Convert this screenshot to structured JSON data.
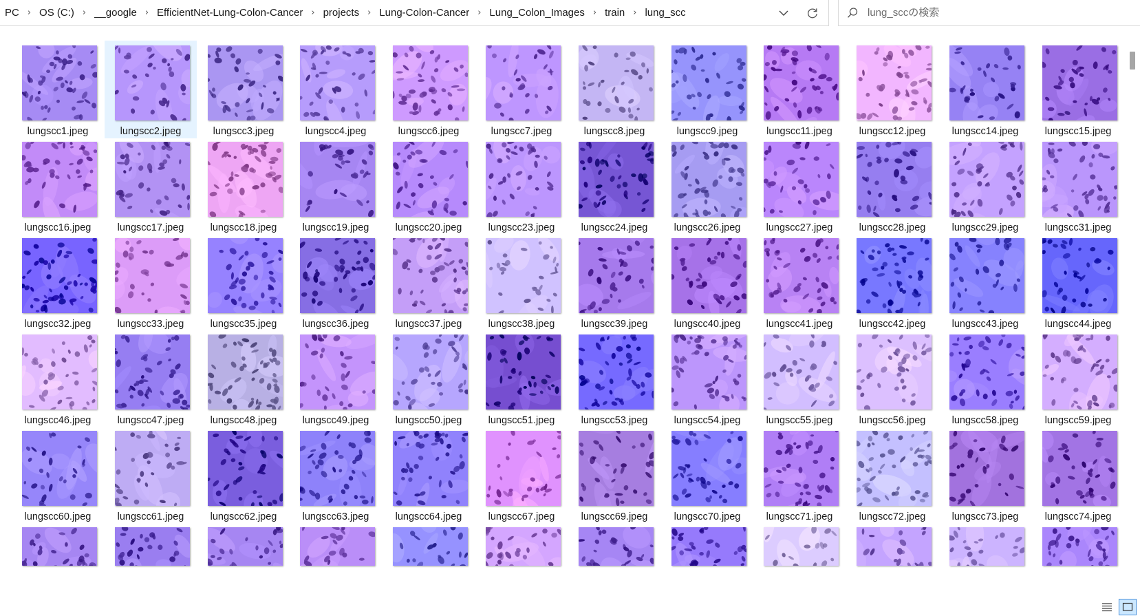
{
  "breadcrumb": {
    "items": [
      "PC",
      "OS (C:)",
      "__google",
      "EfficientNet-Lung-Colon-Cancer",
      "projects",
      "Lung-Colon-Cancer",
      "Lung_Colon_Images",
      "train",
      "lung_scc"
    ],
    "separator": "›"
  },
  "search": {
    "placeholder": "lung_sccの検索"
  },
  "icons": {
    "history": "chevron-down-icon",
    "refresh": "refresh-icon",
    "search": "search-icon",
    "details_view": "details-view-icon",
    "large_icons_view": "large-icons-view-icon"
  },
  "colors": {
    "selection": "#e5f3ff",
    "active_view": "#cce8ff",
    "active_view_border": "#4a90d9"
  },
  "files": [
    "lungscc1.jpeg",
    "lungscc2.jpeg",
    "lungscc3.jpeg",
    "lungscc4.jpeg",
    "lungscc6.jpeg",
    "lungscc7.jpeg",
    "lungscc8.jpeg",
    "lungscc9.jpeg",
    "lungscc11.jpeg",
    "lungscc12.jpeg",
    "lungscc14.jpeg",
    "lungscc15.jpeg",
    "lungscc16.jpeg",
    "lungscc17.jpeg",
    "lungscc18.jpeg",
    "lungscc19.jpeg",
    "lungscc20.jpeg",
    "lungscc23.jpeg",
    "lungscc24.jpeg",
    "lungscc26.jpeg",
    "lungscc27.jpeg",
    "lungscc28.jpeg",
    "lungscc29.jpeg",
    "lungscc31.jpeg",
    "lungscc32.jpeg",
    "lungscc33.jpeg",
    "lungscc35.jpeg",
    "lungscc36.jpeg",
    "lungscc37.jpeg",
    "lungscc38.jpeg",
    "lungscc39.jpeg",
    "lungscc40.jpeg",
    "lungscc41.jpeg",
    "lungscc42.jpeg",
    "lungscc43.jpeg",
    "lungscc44.jpeg",
    "lungscc46.jpeg",
    "lungscc47.jpeg",
    "lungscc48.jpeg",
    "lungscc49.jpeg",
    "lungscc50.jpeg",
    "lungscc51.jpeg",
    "lungscc53.jpeg",
    "lungscc54.jpeg",
    "lungscc55.jpeg",
    "lungscc56.jpeg",
    "lungscc58.jpeg",
    "lungscc59.jpeg",
    "lungscc60.jpeg",
    "lungscc61.jpeg",
    "lungscc62.jpeg",
    "lungscc63.jpeg",
    "lungscc64.jpeg",
    "lungscc67.jpeg",
    "lungscc69.jpeg",
    "lungscc70.jpeg",
    "lungscc71.jpeg",
    "lungscc72.jpeg",
    "lungscc73.jpeg",
    "lungscc74.jpeg"
  ],
  "partial_row_count": 12,
  "selected_file": "lungscc2.jpeg",
  "thumbnail_colors": [
    "#8a6fd8",
    "#9a7ae0",
    "#8e7ad6",
    "#9a80e0",
    "#b27ee6",
    "#a27ae4",
    "#a89ad8",
    "#7a78e0",
    "#9a5ed8",
    "#d69ae6",
    "#7a66d8",
    "#7e52c8",
    "#a66fdc",
    "#9676d8",
    "#d28ad8",
    "#8a6ad6",
    "#9a6ee0",
    "#a07ae2",
    "#5a3ab8",
    "#8a80d6",
    "#9e6ae0",
    "#7a62d4",
    "#a886e4",
    "#9e7ae0",
    "#5c48ea",
    "#c080dc",
    "#7a66ee",
    "#6a52c8",
    "#a882dc",
    "#b4a6e6",
    "#8a5ed0",
    "#8a56cc",
    "#9c66d8",
    "#5c5ce8",
    "#6a66e2",
    "#4a4ae0",
    "#c6a0ea",
    "#7a62d6",
    "#9c94c8",
    "#a878e0",
    "#9a8ae2",
    "#5a32b4",
    "#5a4ee6",
    "#a07ae0",
    "#b6a2ea",
    "#c0a4ee",
    "#7e62ee",
    "#b892e6",
    "#7a6ade",
    "#a290d8",
    "#5e42c2",
    "#7266de",
    "#7466e0",
    "#c476e2",
    "#8a62c4",
    "#6a62e6",
    "#9462da",
    "#a8a4e4",
    "#8656c2",
    "#8658c8",
    "#8a6ad6",
    "#7e62d4",
    "#8a6ad6",
    "#9e72dc",
    "#7a76e4",
    "#b88ae6",
    "#8a6ad8",
    "#7a5ee0",
    "#c0b0e8",
    "#a888e6",
    "#b098e8",
    "#8e6ae0"
  ]
}
